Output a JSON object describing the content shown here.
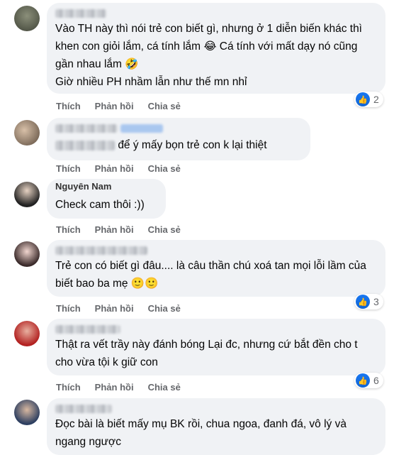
{
  "actions": {
    "like": "Thích",
    "reply": "Phản hồi",
    "share": "Chia sẻ"
  },
  "comments": [
    {
      "name": "",
      "text": "Vào TH này thì nói trẻ con biết gì, nhưng ở 1 diễn biến khác thì khen con giỏi lắm, cá tính lắm 😂 Cá tính với mất dạy nó cũng gần nhau lắm 🤣\nGiờ nhiều PH nhầm lẫn như thế mn nhỉ",
      "reactions": "2"
    },
    {
      "name": "",
      "text": "để ý mấy bọn trẻ con k lại thiệt",
      "reactions": ""
    },
    {
      "name": "Nguyễn Nam",
      "text": "Check cam thôi :))",
      "reactions": ""
    },
    {
      "name": "",
      "text": "Trẻ con có biết gì đâu.... là câu thần chú xoá tan mọi lỗi lầm của biết bao ba mẹ 🙂🙂",
      "reactions": "3"
    },
    {
      "name": "",
      "text": "Thật ra vết trầy này đánh bóng Lại đc, nhưng cứ bắt đền cho t cho vừa tội k giữ con",
      "reactions": "6"
    },
    {
      "name": "",
      "text": "Đọc bài là biết mấy mụ BK rồi, chua ngoa, đanh đá, vô lý và ngang ngược",
      "reactions": ""
    }
  ],
  "colors": {
    "bubble": "#f0f2f5",
    "like": "#1877f2",
    "action_text": "#65676b"
  },
  "icons": {
    "like": "like-icon"
  }
}
